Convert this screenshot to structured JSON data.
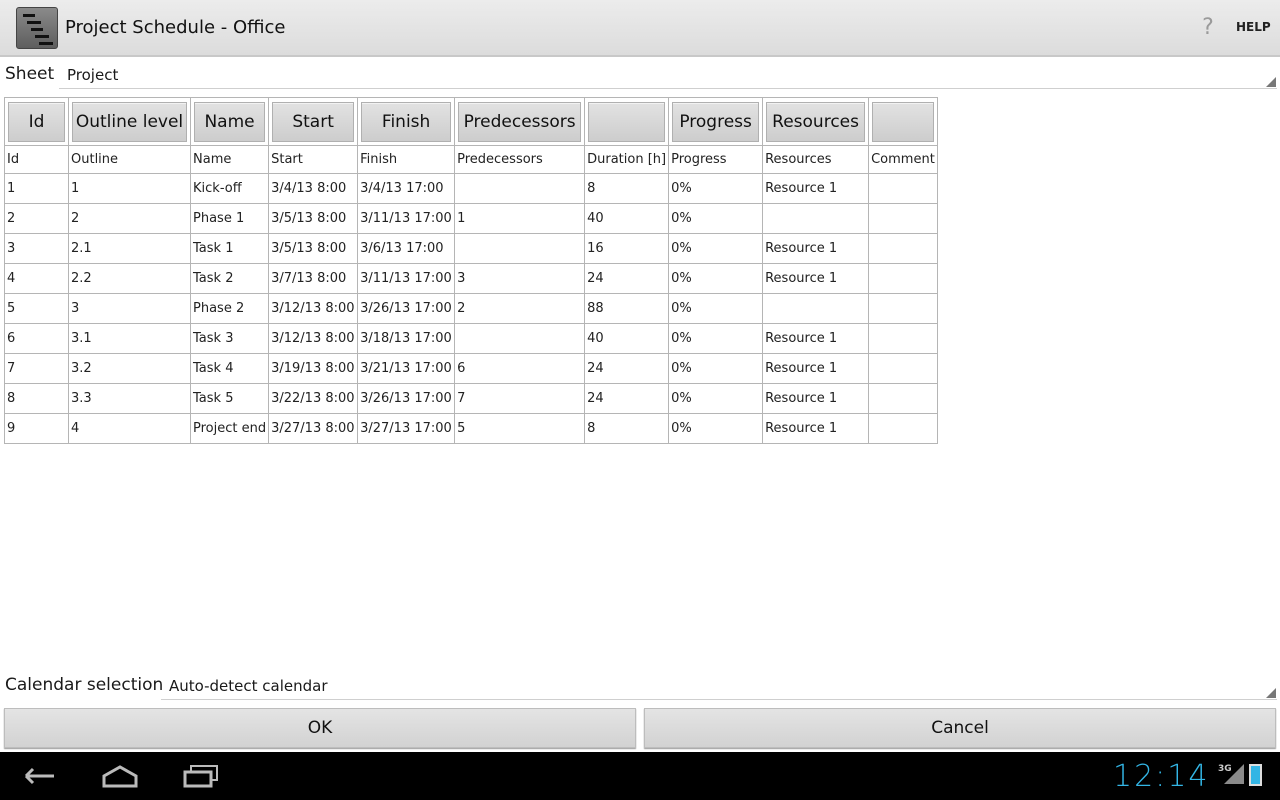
{
  "app": {
    "title": "Project Schedule - Office",
    "help_label": "HELP"
  },
  "sheet": {
    "label": "Sheet",
    "value": "Project"
  },
  "columns": [
    {
      "button": "Id",
      "header": "Id"
    },
    {
      "button": "Outline level",
      "header": "Outline"
    },
    {
      "button": "Name",
      "header": "Name"
    },
    {
      "button": "Start",
      "header": "Start"
    },
    {
      "button": "Finish",
      "header": "Finish"
    },
    {
      "button": "Predecessors",
      "header": "Predecessors"
    },
    {
      "button": "",
      "header": "Duration [h]"
    },
    {
      "button": "Progress",
      "header": "Progress"
    },
    {
      "button": "Resources",
      "header": "Resources"
    },
    {
      "button": "",
      "header": "Comment"
    }
  ],
  "rows": [
    [
      "1",
      "1",
      "Kick-off",
      "3/4/13 8:00",
      "3/4/13 17:00",
      "",
      "8",
      "0%",
      "Resource 1",
      ""
    ],
    [
      "2",
      "2",
      "Phase 1",
      "3/5/13 8:00",
      "3/11/13 17:00",
      "1",
      "40",
      "0%",
      "",
      ""
    ],
    [
      "3",
      "2.1",
      "Task 1",
      "3/5/13 8:00",
      "3/6/13 17:00",
      "",
      "16",
      "0%",
      "Resource 1",
      ""
    ],
    [
      "4",
      "2.2",
      "Task 2",
      "3/7/13 8:00",
      "3/11/13 17:00",
      "3",
      "24",
      "0%",
      "Resource 1",
      ""
    ],
    [
      "5",
      "3",
      "Phase 2",
      "3/12/13 8:00",
      "3/26/13 17:00",
      "2",
      "88",
      "0%",
      "",
      ""
    ],
    [
      "6",
      "3.1",
      "Task 3",
      "3/12/13 8:00",
      "3/18/13 17:00",
      "",
      "40",
      "0%",
      "Resource 1",
      ""
    ],
    [
      "7",
      "3.2",
      "Task 4",
      "3/19/13 8:00",
      "3/21/13 17:00",
      "6",
      "24",
      "0%",
      "Resource 1",
      ""
    ],
    [
      "8",
      "3.3",
      "Task 5",
      "3/22/13 8:00",
      "3/26/13 17:00",
      "7",
      "24",
      "0%",
      "Resource 1",
      ""
    ],
    [
      "9",
      "4",
      "Project end",
      "3/27/13 8:00",
      "3/27/13 17:00",
      "5",
      "8",
      "0%",
      "Resource 1",
      ""
    ]
  ],
  "calendar": {
    "label": "Calendar selection",
    "value": "Auto-detect calendar"
  },
  "buttons": {
    "ok": "OK",
    "cancel": "Cancel"
  },
  "status": {
    "clock": "12:14",
    "network": "3G"
  },
  "colors": {
    "accent": "#33b5e5"
  },
  "icons": {
    "app": "gantt-app-icon",
    "help": "help-icon",
    "back": "back-icon",
    "home": "home-icon",
    "recents": "recent-apps-icon"
  }
}
